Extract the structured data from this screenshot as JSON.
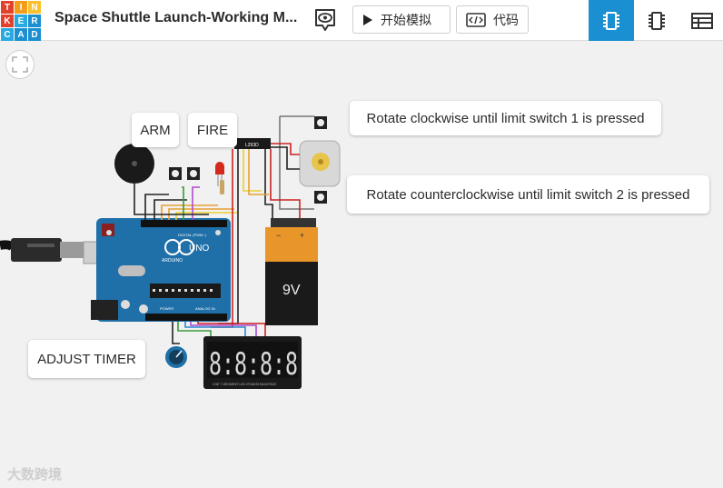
{
  "app": {
    "logo_letters": [
      "T",
      "I",
      "N",
      "K",
      "E",
      "R",
      "C",
      "A",
      "D"
    ],
    "logo_colors": [
      "#e2412b",
      "#f59c18",
      "#fbc02d",
      "#e2412b",
      "#28a9e0",
      "#1a8fd1",
      "#28a9e0",
      "#1a8fd1",
      "#1a8fd1"
    ],
    "title": "Space Shuttle Launch-Working M...",
    "accent": "#1a8fd1"
  },
  "toolbar": {
    "start_sim_label": "开始模拟",
    "code_label": "代码",
    "eye_icon": "eye-icon",
    "views": [
      "components-icon",
      "chip-icon",
      "table-icon"
    ]
  },
  "canvas": {
    "callouts": {
      "arm": "ARM",
      "fire": "FIRE",
      "rotate_cw": "Rotate clockwise until limit switch 1 is pressed",
      "rotate_ccw": "Rotate counterclockwise until limit switch 2 is pressed",
      "adjust_timer": "ADJUST TIMER"
    },
    "battery_label": "9V",
    "battery_minus": "−",
    "battery_plus": "+",
    "motor_driver_label": "L293D",
    "arduino_label": "UNO",
    "arduino_brand": "ARDUINO",
    "arduino_digital": "DIGITAL (PWM~)",
    "arduino_power": "POWER",
    "arduino_analog": "ANALOG IN",
    "display_digits": "8:8:8:8",
    "display_caption": "0.56\" 7-SEGMENT LED HT16K33 BACKPACK"
  },
  "watermark": "大数跨境"
}
